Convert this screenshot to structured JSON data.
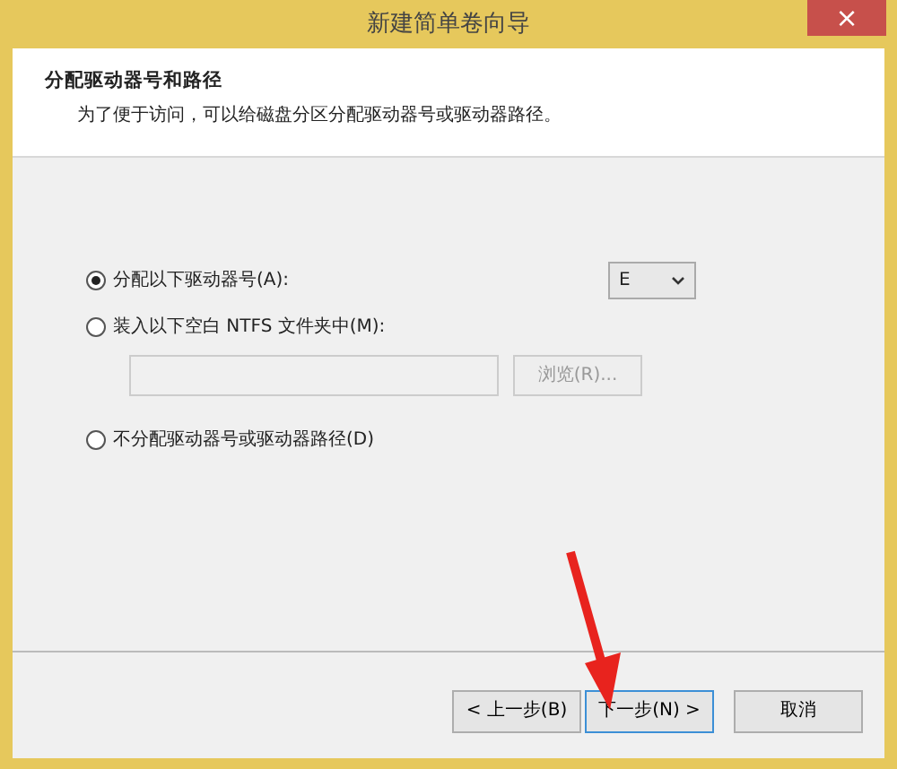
{
  "window": {
    "title": "新建简单卷向导",
    "close": "×"
  },
  "header": {
    "title": "分配驱动器号和路径",
    "subtitle": "为了便于访问，可以给磁盘分区分配驱动器号或驱动器路径。"
  },
  "options": [
    {
      "label": "分配以下驱动器号(A):",
      "selected": true,
      "kind": "drive"
    },
    {
      "label": "装入以下空白 NTFS 文件夹中(M):",
      "selected": false,
      "kind": "folder"
    },
    {
      "label": "不分配驱动器号或驱动器路径(D)",
      "selected": false,
      "kind": "none"
    }
  ],
  "drive_letter": {
    "value": "E"
  },
  "folder_path": {
    "disabled": true
  },
  "browse_button": {
    "label": "浏览(R)...",
    "disabled": true
  },
  "buttons": [
    {
      "label": "< 上一步(B)",
      "kind": "back"
    },
    {
      "label": "下一步(N) >",
      "kind": "next"
    },
    {
      "label": "取消",
      "kind": "cancel"
    }
  ],
  "annotation": {
    "kind": "arrow"
  }
}
